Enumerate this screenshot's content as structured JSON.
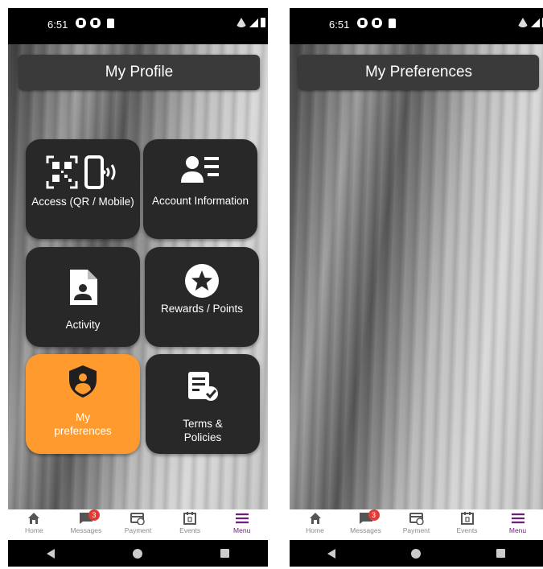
{
  "status": {
    "time": "6:51"
  },
  "profile_screen": {
    "title": "My Profile",
    "tiles": [
      {
        "label": "Access  (QR / Mobile)",
        "icon": "qr-mobile-icon"
      },
      {
        "label": "Account Information",
        "icon": "account-card-icon"
      },
      {
        "label": "Activity",
        "icon": "document-person-icon"
      },
      {
        "label": "Rewards / Points",
        "icon": "star-badge-icon"
      },
      {
        "label": "My preferences",
        "icon": "shield-person-icon",
        "selected": true
      },
      {
        "label": "Terms & Policies",
        "icon": "document-check-icon"
      }
    ]
  },
  "preferences_screen": {
    "title": "My Preferences"
  },
  "tabbar": {
    "items": [
      {
        "label": "Home",
        "icon": "home-icon"
      },
      {
        "label": "Messages",
        "icon": "chat-icon",
        "badge": "3"
      },
      {
        "label": "Payment",
        "icon": "payment-icon"
      },
      {
        "label": "Events",
        "icon": "calendar-icon"
      },
      {
        "label": "Menu",
        "icon": "menu-icon",
        "active": true
      }
    ]
  },
  "colors": {
    "tile": "#282828",
    "tile_selected": "#ff9a2e",
    "accent": "#6b1f7a",
    "badge": "#e53935"
  }
}
